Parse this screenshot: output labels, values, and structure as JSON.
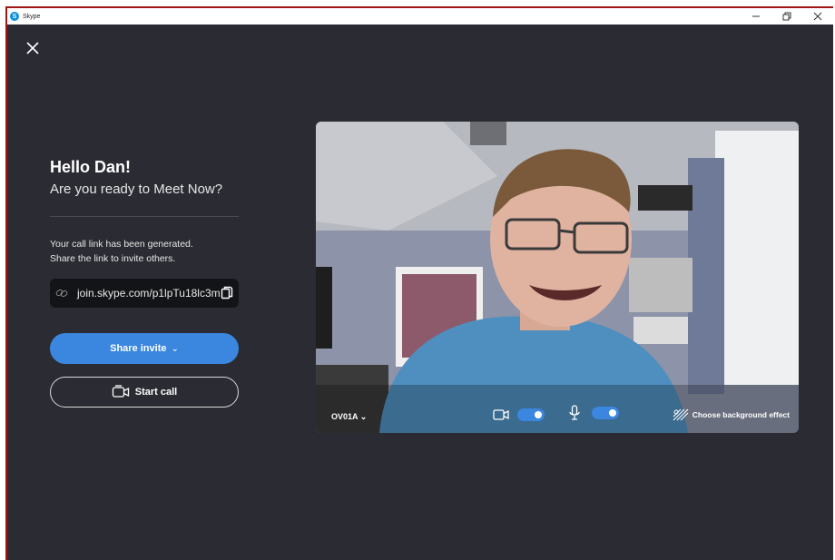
{
  "window": {
    "app_title": "Skype",
    "app_icon": "skype-logo-icon",
    "controls": [
      "minimize-icon",
      "restore-icon",
      "close-icon"
    ]
  },
  "greeting": {
    "title": "Hello Dan!",
    "subtitle": "Are you ready to Meet Now?"
  },
  "link": {
    "message_line1": "Your call link has been generated.",
    "message_line2": "Share the link to invite others.",
    "url": "join.skype.com/p1lpTu18lc3m"
  },
  "buttons": {
    "share_invite": "Share invite",
    "start_call": "Start call"
  },
  "video_preview": {
    "device_name": "OV01A",
    "camera_enabled": true,
    "microphone_enabled": true,
    "background_effect_label": "Choose background effect"
  },
  "colors": {
    "accent": "#3b86df",
    "background": "#2b2c33",
    "window_border": "#a31515"
  }
}
